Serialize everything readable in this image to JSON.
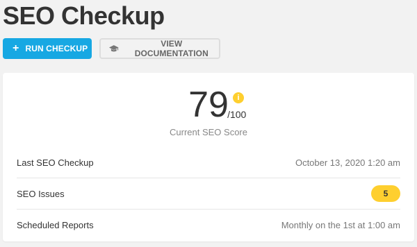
{
  "page": {
    "title": "SEO Checkup"
  },
  "actions": {
    "run_label": "RUN CHECKUP",
    "run_icon": "+",
    "docs_label": "VIEW DOCUMENTATION"
  },
  "score": {
    "value": "79",
    "max": "/100",
    "info_icon": "i",
    "label": "Current SEO Score"
  },
  "rows": [
    {
      "label": "Last SEO Checkup",
      "value": "October 13, 2020 1:20 am"
    },
    {
      "label": "SEO Issues",
      "value": "5"
    },
    {
      "label": "Scheduled Reports",
      "value": "Monthly on the 1st at 1:00 am"
    }
  ],
  "colors": {
    "primary": "#17a8e3",
    "badge": "#fecf2f"
  }
}
